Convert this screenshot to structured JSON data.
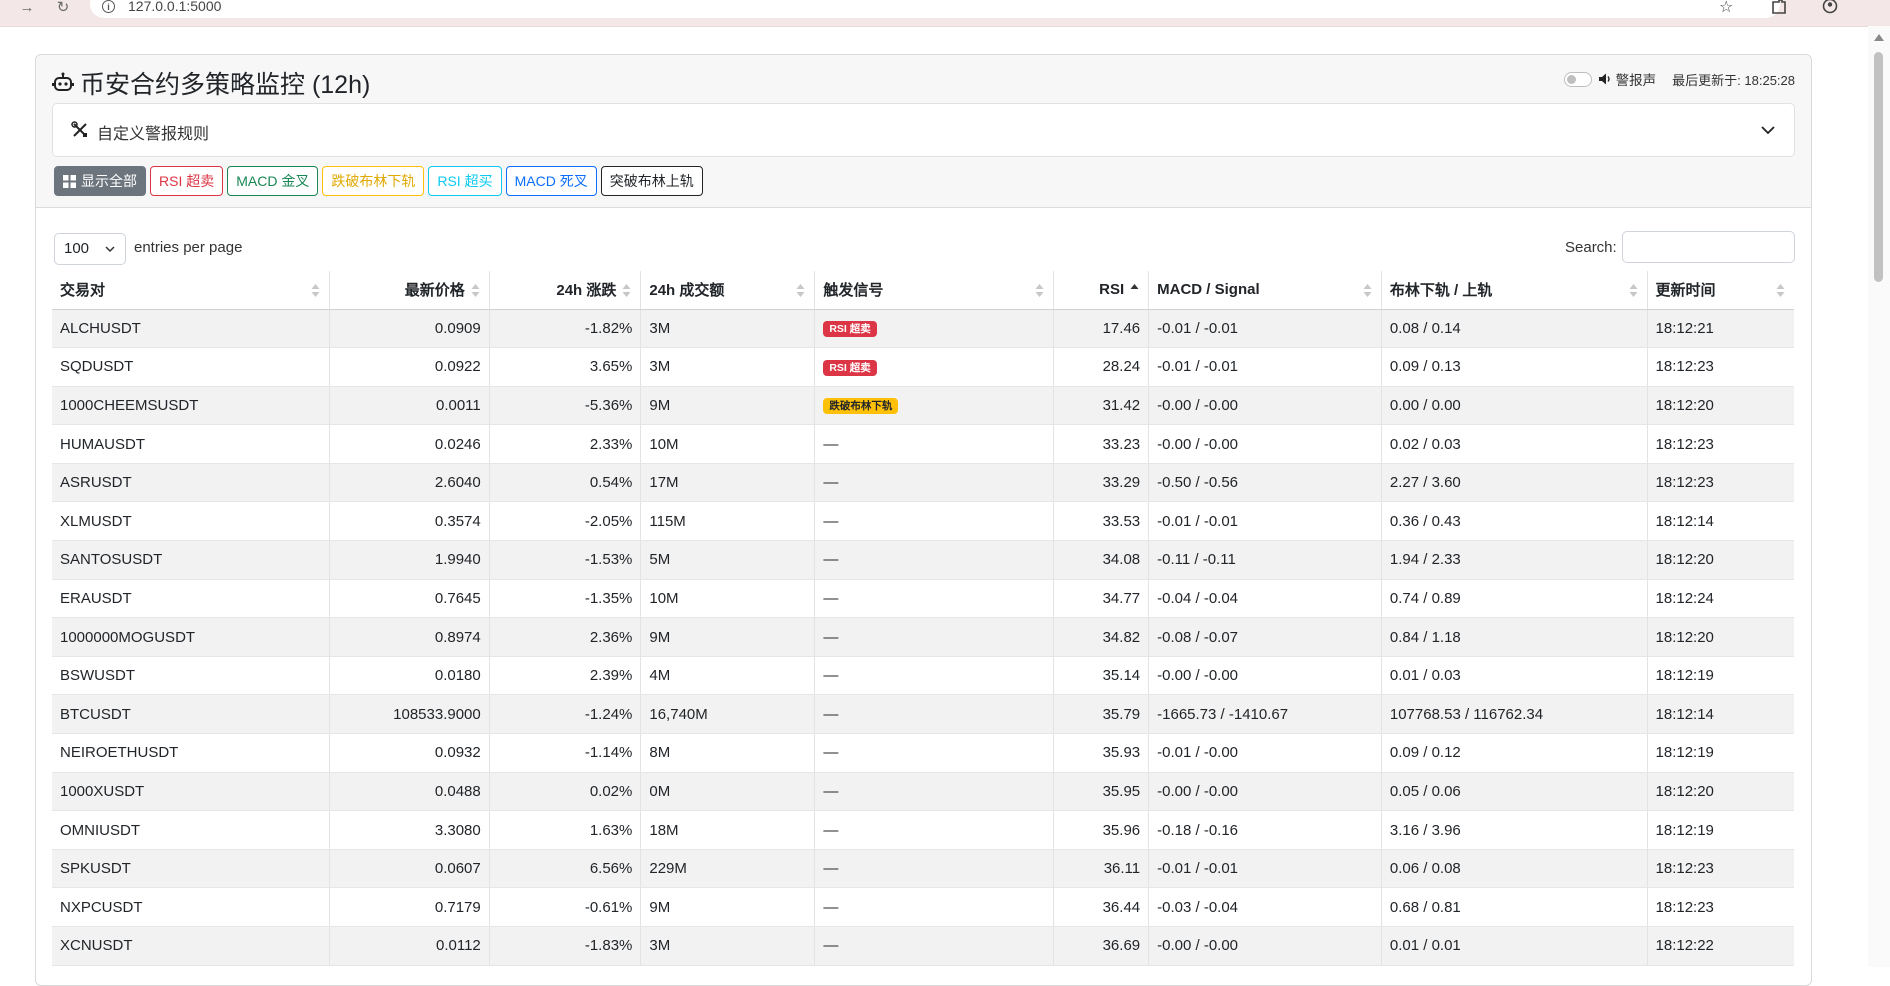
{
  "browser": {
    "url": "127.0.0.1:5000",
    "icons": [
      "forward-icon",
      "reload-icon",
      "site-info-icon",
      "star-icon",
      "extensions-icon",
      "profile-icon"
    ]
  },
  "header": {
    "title": "币安合约多策略监控 (12h)",
    "alarm_label": "警报声",
    "last_updated": "最后更新于: 18:25:28"
  },
  "rules": {
    "label": "自定义警报规则"
  },
  "filters": [
    {
      "label": "显示全部",
      "color": "#6c757d"
    },
    {
      "label": "RSI 超卖",
      "color": "#dc3545"
    },
    {
      "label": "MACD 金叉",
      "color": "#198754"
    },
    {
      "label": "跌破布林下轨",
      "color": "#ffc107"
    },
    {
      "label": "RSI 超买",
      "color": "#0dcaf0"
    },
    {
      "label": "MACD 死叉",
      "color": "#0d6efd"
    },
    {
      "label": "突破布林上轨",
      "color": "#212529"
    }
  ],
  "table_controls": {
    "page_length": "100",
    "entries_label": "entries per page",
    "search_label": "Search:"
  },
  "table": {
    "columns": [
      "交易对",
      "最新价格",
      "24h 涨跌",
      "24h 成交额",
      "触发信号",
      "RSI",
      "MACD / Signal",
      "布林下轨 / 上轨",
      "更新时间"
    ],
    "rows": [
      [
        "ALCHUSDT",
        "0.0909",
        "-1.82%",
        "3M",
        "RSI 超卖",
        "17.46",
        "-0.01 / -0.01",
        "0.08 / 0.14",
        "18:12:21"
      ],
      [
        "SQDUSDT",
        "0.0922",
        "3.65%",
        "3M",
        "RSI 超卖",
        "28.24",
        "-0.01 / -0.01",
        "0.09 / 0.13",
        "18:12:23"
      ],
      [
        "1000CHEEMSUSDT",
        "0.0011",
        "-5.36%",
        "9M",
        "跌破布林下轨",
        "31.42",
        "-0.00 / -0.00",
        "0.00 / 0.00",
        "18:12:20"
      ],
      [
        "HUMAUSDT",
        "0.0246",
        "2.33%",
        "10M",
        "—",
        "33.23",
        "-0.00 / -0.00",
        "0.02 / 0.03",
        "18:12:23"
      ],
      [
        "ASRUSDT",
        "2.6040",
        "0.54%",
        "17M",
        "—",
        "33.29",
        "-0.50 / -0.56",
        "2.27 / 3.60",
        "18:12:23"
      ],
      [
        "XLMUSDT",
        "0.3574",
        "-2.05%",
        "115M",
        "—",
        "33.53",
        "-0.01 / -0.01",
        "0.36 / 0.43",
        "18:12:14"
      ],
      [
        "SANTOSUSDT",
        "1.9940",
        "-1.53%",
        "5M",
        "—",
        "34.08",
        "-0.11 / -0.11",
        "1.94 / 2.33",
        "18:12:20"
      ],
      [
        "ERAUSDT",
        "0.7645",
        "-1.35%",
        "10M",
        "—",
        "34.77",
        "-0.04 / -0.04",
        "0.74 / 0.89",
        "18:12:24"
      ],
      [
        "1000000MOGUSDT",
        "0.8974",
        "2.36%",
        "9M",
        "—",
        "34.82",
        "-0.08 / -0.07",
        "0.84 / 1.18",
        "18:12:20"
      ],
      [
        "BSWUSDT",
        "0.0180",
        "2.39%",
        "4M",
        "—",
        "35.14",
        "-0.00 / -0.00",
        "0.01 / 0.03",
        "18:12:19"
      ],
      [
        "BTCUSDT",
        "108533.9000",
        "-1.24%",
        "16,740M",
        "—",
        "35.79",
        "-1665.73 / -1410.67",
        "107768.53 / 116762.34",
        "18:12:14"
      ],
      [
        "NEIROETHUSDT",
        "0.0932",
        "-1.14%",
        "8M",
        "—",
        "35.93",
        "-0.01 / -0.00",
        "0.09 / 0.12",
        "18:12:19"
      ],
      [
        "1000XUSDT",
        "0.0488",
        "0.02%",
        "0M",
        "—",
        "35.95",
        "-0.00 / -0.00",
        "0.05 / 0.06",
        "18:12:20"
      ],
      [
        "OMNIUSDT",
        "3.3080",
        "1.63%",
        "18M",
        "—",
        "35.96",
        "-0.18 / -0.16",
        "3.16 / 3.96",
        "18:12:19"
      ],
      [
        "SPKUSDT",
        "0.0607",
        "6.56%",
        "229M",
        "—",
        "36.11",
        "-0.01 / -0.01",
        "0.06 / 0.08",
        "18:12:23"
      ],
      [
        "NXPCUSDT",
        "0.7179",
        "-0.61%",
        "9M",
        "—",
        "36.44",
        "-0.03 / -0.04",
        "0.68 / 0.81",
        "18:12:23"
      ],
      [
        "XCNUSDT",
        "0.0112",
        "-1.83%",
        "3M",
        "—",
        "36.69",
        "-0.00 / -0.00",
        "0.01 / 0.01",
        "18:12:22"
      ]
    ]
  }
}
